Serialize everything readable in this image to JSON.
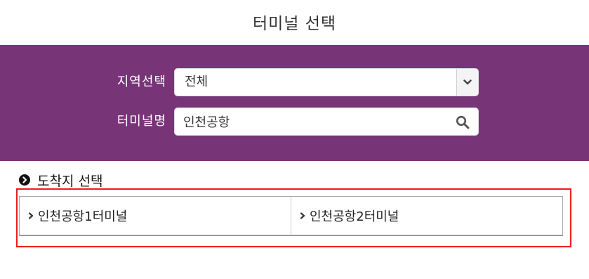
{
  "page": {
    "title": "터미널 선택"
  },
  "search": {
    "region_label": "지역선택",
    "region_value": "전체",
    "terminal_label": "터미널명",
    "terminal_value": "인천공항"
  },
  "destination": {
    "heading": "도착지 선택",
    "results": [
      {
        "label": "인천공항1터미널",
        "icon": "chevron-right-icon"
      },
      {
        "label": "인천공항2터미널",
        "icon": "chevron-right-icon"
      }
    ]
  },
  "colors": {
    "panel": "#773578",
    "highlight": "#ee1c1c"
  },
  "icons": {
    "dropdown": "chevron-down-icon",
    "search": "search-icon",
    "heading_bullet": "circle-arrow-right-icon"
  }
}
